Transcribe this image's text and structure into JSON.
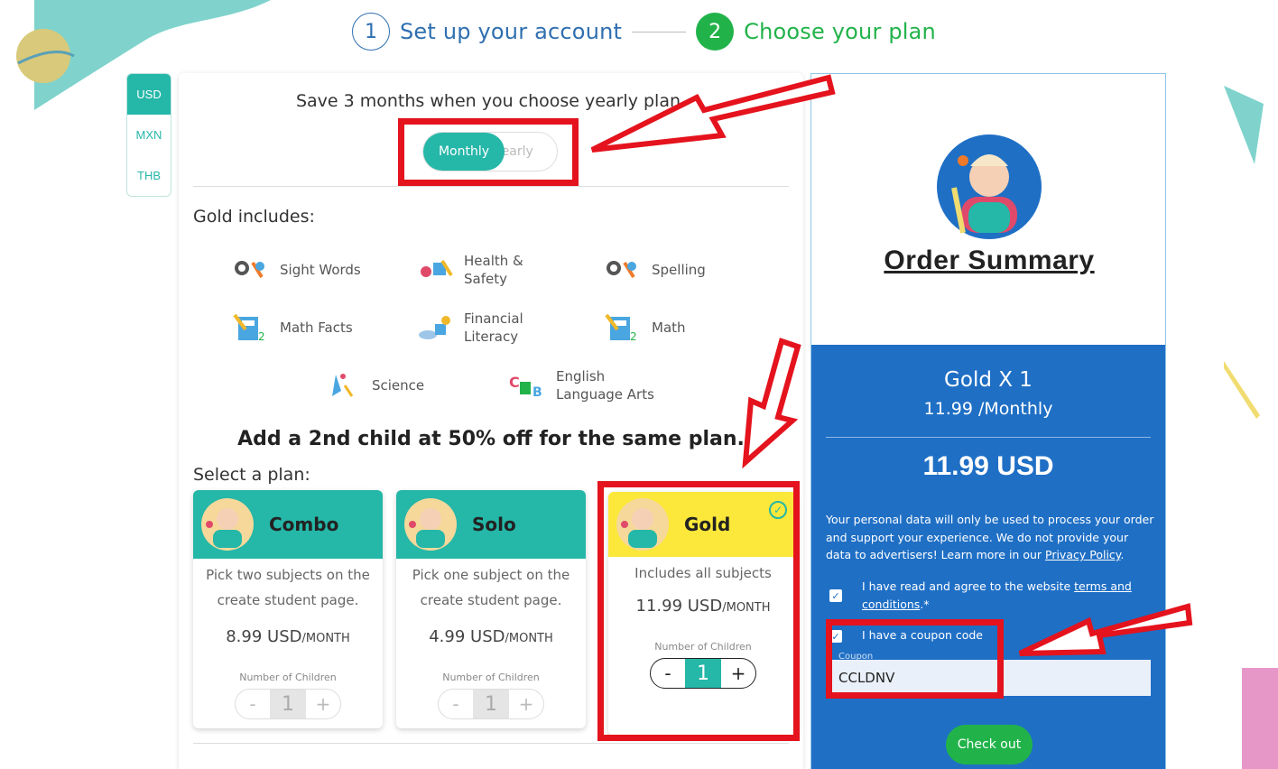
{
  "stepper": {
    "step1_num": "1",
    "step1_label": "Set up your account",
    "step2_num": "2",
    "step2_label": "Choose your plan"
  },
  "currency": {
    "tabs": [
      "USD",
      "MXN",
      "THB"
    ],
    "active": "USD"
  },
  "plans_panel": {
    "save_text": "Save 3 months when you choose yearly plan.",
    "toggle_monthly": "Monthly",
    "toggle_yearly": "Yearly",
    "gold_includes": "Gold includes:",
    "subjects": [
      {
        "label": "Sight Words",
        "icon": "sight-words-icon"
      },
      {
        "label": "Health & Safety",
        "icon": "health-safety-icon"
      },
      {
        "label": "Spelling",
        "icon": "spelling-icon"
      },
      {
        "label": "Math Facts",
        "icon": "math-facts-icon"
      },
      {
        "label": "Financial Literacy",
        "icon": "financial-literacy-icon"
      },
      {
        "label": "Math",
        "icon": "math-icon"
      },
      {
        "label": "Science",
        "icon": "science-icon"
      },
      {
        "label": "English Language Arts",
        "icon": "english-language-arts-icon"
      }
    ],
    "second_child_text": "Add a 2nd child at 50% off for the same plan.",
    "select_plan": "Select a plan:",
    "cards": [
      {
        "name": "Combo",
        "desc": "Pick two subjects on the create student page.",
        "price": "8.99 USD",
        "per": "/MONTH",
        "children_label": "Number of Children",
        "children": "1",
        "minus": "-",
        "plus": "+"
      },
      {
        "name": "Solo",
        "desc": "Pick one subject on the create student page.",
        "price": "4.99 USD",
        "per": "/MONTH",
        "children_label": "Number of Children",
        "children": "1",
        "minus": "-",
        "plus": "+"
      },
      {
        "name": "Gold",
        "desc": "Includes all subjects",
        "price": "11.99 USD",
        "per": "/MONTH",
        "children_label": "Number of Children",
        "children": "1",
        "minus": "-",
        "plus": "+",
        "selected": true
      }
    ]
  },
  "summary": {
    "title": "Order Summary",
    "plan_line": "Gold X 1",
    "price_line": "11.99 /Monthly",
    "total": "11.99 USD",
    "privacy_text": "Your personal data will only be used to process your order and support your experience. We do not provide your data to advertisers! Learn more in our ",
    "privacy_link": "Privacy Policy",
    "privacy_end": ".",
    "terms_text": "I have read and agree to the website ",
    "terms_link": "terms and conditions",
    "terms_end": ".*",
    "coupon_label": "I have a coupon code",
    "coupon_small": "Coupon",
    "coupon_value": "CCLDNV",
    "checkout": "Check out"
  },
  "colors": {
    "teal": "#25b7a8",
    "green": "#21b34a",
    "blue": "#1f6fc5",
    "gold": "#fce83a",
    "annotation_red": "#e4131d"
  }
}
